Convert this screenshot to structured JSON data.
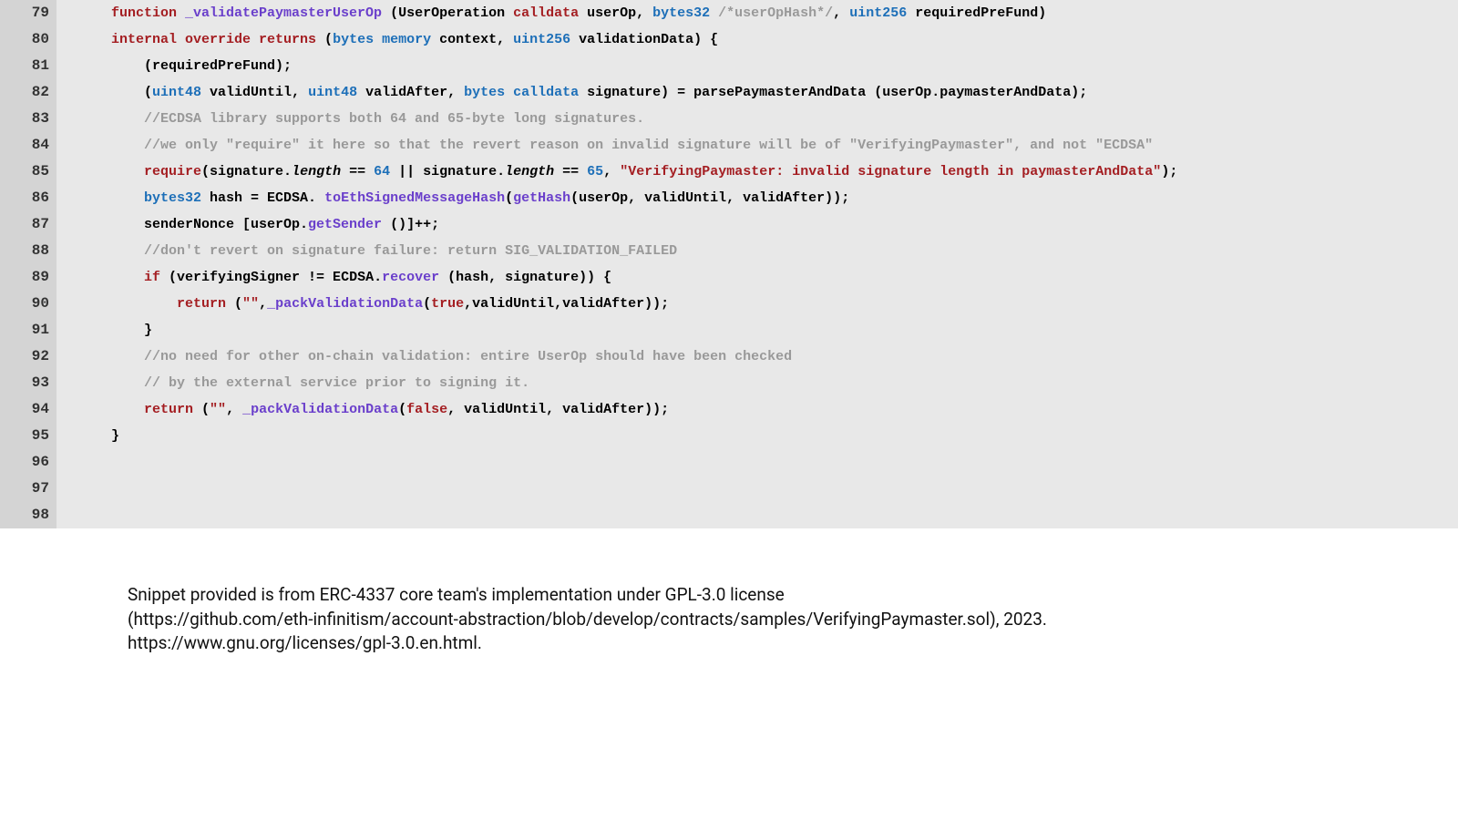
{
  "lineNumbers": [
    "79",
    "80",
    "81",
    "82",
    "83",
    "84",
    "85",
    "86",
    "87",
    "88",
    "89",
    "90",
    "91",
    "92",
    "93",
    "94",
    "95",
    "96",
    "97",
    "98"
  ],
  "attribution": {
    "line1": "Snippet provided is from ERC-4337 core team's implementation under GPL-3.0 license",
    "line2": "(https://github.com/eth-infinitism/account-abstraction/blob/develop/contracts/samples/VerifyingPaymaster.sol), 2023.",
    "line3": "https://www.gnu.org/licenses/gpl-3.0.en.html."
  },
  "code": {
    "l79": {
      "t1": "function",
      "t2": " _validatePaymasterUserOp",
      "t3": " (UserOperation",
      "t4": " calldata",
      "t5": " userOp,",
      "t6": " bytes32",
      "t7": " /*userOpHash*/",
      "t8": ",",
      "t9": " uint256",
      "t10": " requiredPreFund)"
    },
    "l80": {
      "t1": "internal override returns",
      "t2": " (",
      "t3": "bytes memory",
      "t4": " context,",
      "t5": " uint256",
      "t6": " validationData) {"
    },
    "l81": {
      "t1": "    (requiredPreFund);"
    },
    "l82": {
      "t1": ""
    },
    "l83": {
      "t1": "    (",
      "t2": "uint48",
      "t3": " validUntil,",
      "t4": " uint48",
      "t5": " validAfter,",
      "t6": " bytes calldata",
      "t7": " signature) = parsePaymasterAndData (userOp.paymasterAndData);"
    },
    "l84": {
      "t1": "    //ECDSA library supports both 64 and 65-byte long signatures."
    },
    "l85": {
      "t1": "    //we only \"require\" it here so that the revert reason on invalid signature will be of \"VerifyingPaymaster\", and not \"ECDSA\""
    },
    "l86": {
      "t1": "    ",
      "t2": "require",
      "t3": "(signature.",
      "t4": "length",
      "t5": " ==",
      "t6": " 64",
      "t7": " || signature.",
      "t8": "length",
      "t9": " ==",
      "t10": " 65",
      "t11": ",",
      "t12": " \"VerifyingPaymaster: invalid signature length in paymasterAndData\"",
      "t13": ");"
    },
    "l87": {
      "t1": "    ",
      "t2": "bytes32",
      "t3": " hash = ECDSA.",
      "t4": " toEthSignedMessageHash",
      "t5": "(",
      "t6": "getHash",
      "t7": "(userOp, validUntil, validAfter));"
    },
    "l88": {
      "t1": "    senderNonce [userOp.",
      "t2": "getSender",
      "t3": " ()]++;"
    },
    "l89": {
      "t1": ""
    },
    "l90": {
      "t1": "    //don't revert on signature failure: return SIG_VALIDATION_FAILED"
    },
    "l91": {
      "t1": "    ",
      "t2": "if",
      "t3": " (verifyingSigner != ECDSA.",
      "t4": "recover",
      "t5": " (hash, signature)) {"
    },
    "l92": {
      "t1": "        ",
      "t2": "return",
      "t3": " (",
      "t4": "\"\"",
      "t5": ",",
      "t6": "_packValidationData",
      "t7": "(",
      "t8": "true",
      "t9": ",validUntil,validAfter));"
    },
    "l93": {
      "t1": "    }"
    },
    "l94": {
      "t1": ""
    },
    "l95": {
      "t1": "    //no need for other on-chain validation: entire UserOp should have been checked"
    },
    "l96": {
      "t1": "    // by the external service prior to signing it."
    },
    "l97": {
      "t1": "    ",
      "t2": "return",
      "t3": " (",
      "t4": "\"\"",
      "t5": ",",
      "t6": " _packValidationData",
      "t7": "(",
      "t8": "false",
      "t9": ", validUntil, validAfter));"
    },
    "l98": {
      "t1": "}"
    }
  }
}
